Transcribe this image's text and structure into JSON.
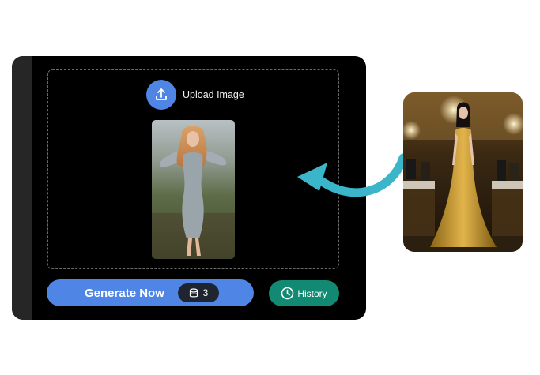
{
  "upload": {
    "label": "Upload Image",
    "icon": "upload-icon"
  },
  "actions": {
    "generate_label": "Generate Now",
    "credits": "3",
    "credits_icon": "database-icon",
    "history_label": "History",
    "history_icon": "clock-icon"
  },
  "colors": {
    "panel_bg": "#000000",
    "primary_blue": "#4f86e6",
    "history_green": "#128a73",
    "arrow_teal": "#3bb5c9"
  }
}
